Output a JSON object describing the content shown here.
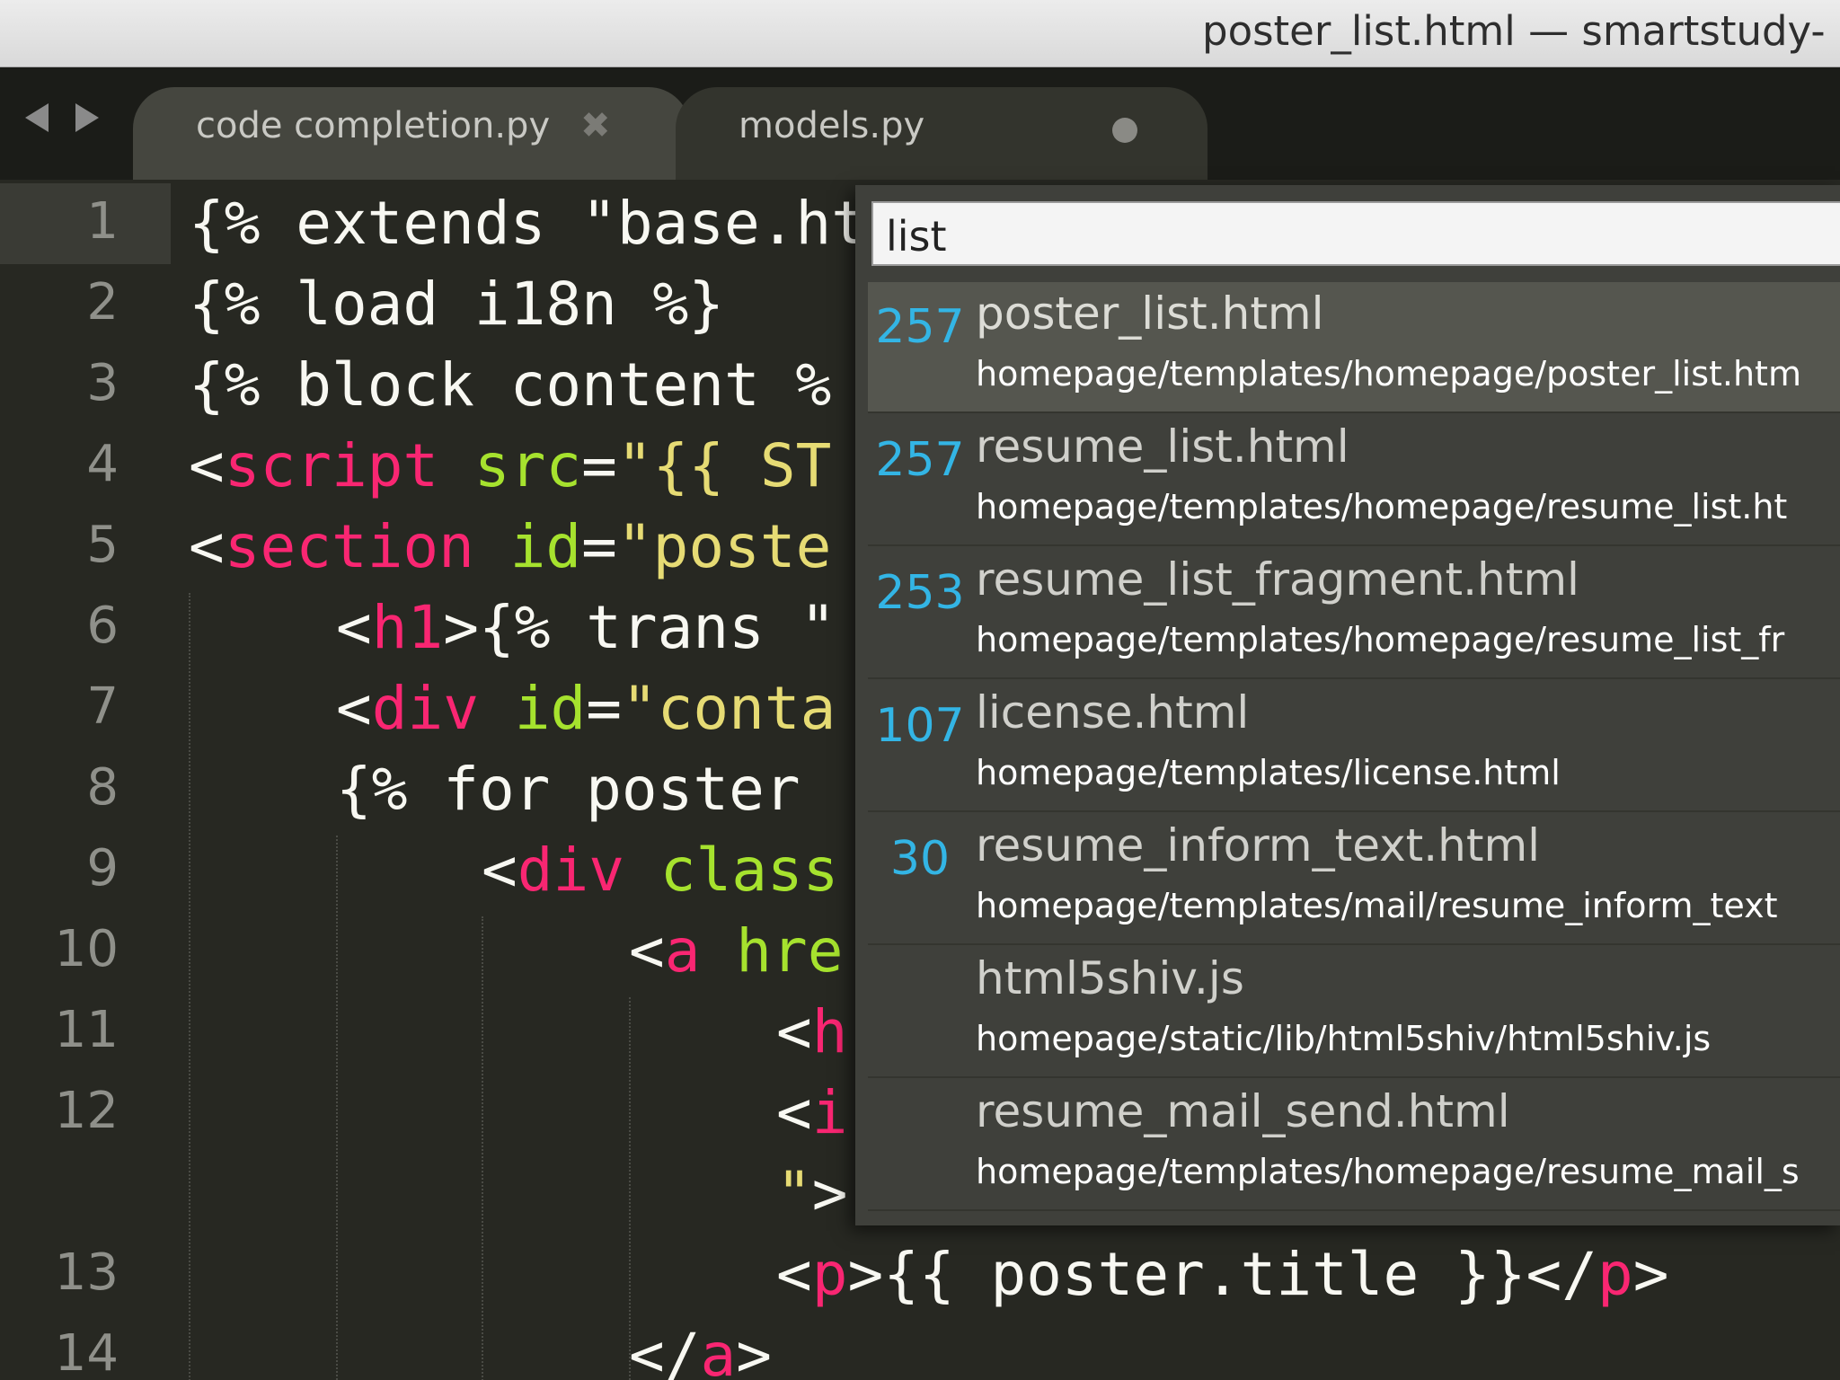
{
  "window": {
    "title": "poster_list.html — smartstudy-"
  },
  "tabs": [
    {
      "label": "code completion.py",
      "close_glyph": "✖",
      "state": "active"
    },
    {
      "label": "models.py",
      "state": "modified"
    }
  ],
  "editor": {
    "lines": [
      {
        "num": "1",
        "code": "{% extends \"base.ht"
      },
      {
        "num": "2",
        "code": "{% load i18n %}"
      },
      {
        "num": "3",
        "code": "{% block content %"
      },
      {
        "num": "4",
        "tag": "script",
        "attr": "src",
        "str": "\"{{ ST"
      },
      {
        "num": "5",
        "tag": "section",
        "attr": "id",
        "str": "\"poste"
      },
      {
        "num": "6",
        "tag": "h1",
        "rest": "{% trans \""
      },
      {
        "num": "7",
        "tag": "div",
        "attr": "id",
        "str": "\"conta"
      },
      {
        "num": "8",
        "code": "{% for poster"
      },
      {
        "num": "9",
        "tag": "div",
        "attr": "class"
      },
      {
        "num": "10",
        "tag": "a",
        "attr": "hre"
      },
      {
        "num": "11",
        "tag": "h"
      },
      {
        "num": "12",
        "tag": "i"
      },
      {
        "num": "",
        "str": "\"",
        "rest": ">"
      },
      {
        "num": "13",
        "tag": "p",
        "rest": "{{ poster.title }}</",
        "tag_close": "p"
      },
      {
        "num": "14",
        "tag_close": "a"
      }
    ]
  },
  "goto_anything": {
    "query": "list",
    "results": [
      {
        "score": "257",
        "name": "poster_list.html",
        "path": "homepage/templates/homepage/poster_list.htm",
        "selected": true
      },
      {
        "score": "257",
        "name": "resume_list.html",
        "path": "homepage/templates/homepage/resume_list.ht"
      },
      {
        "score": "253",
        "name": "resume_list_fragment.html",
        "path": "homepage/templates/homepage/resume_list_fr"
      },
      {
        "score": "107",
        "name": "license.html",
        "path": "homepage/templates/license.html"
      },
      {
        "score": "30",
        "name": "resume_inform_text.html",
        "path": "homepage/templates/mail/resume_inform_text"
      },
      {
        "score": "",
        "name": "html5shiv.js",
        "path": "homepage/static/lib/html5shiv/html5shiv.js"
      },
      {
        "score": "",
        "name": "resume_mail_send.html",
        "path": "homepage/templates/homepage/resume_mail_s"
      }
    ]
  },
  "colors": {
    "background": "#272822",
    "tag": "#f92672",
    "attribute": "#a6e22e",
    "string": "#e6db74",
    "score": "#33b5e5"
  }
}
